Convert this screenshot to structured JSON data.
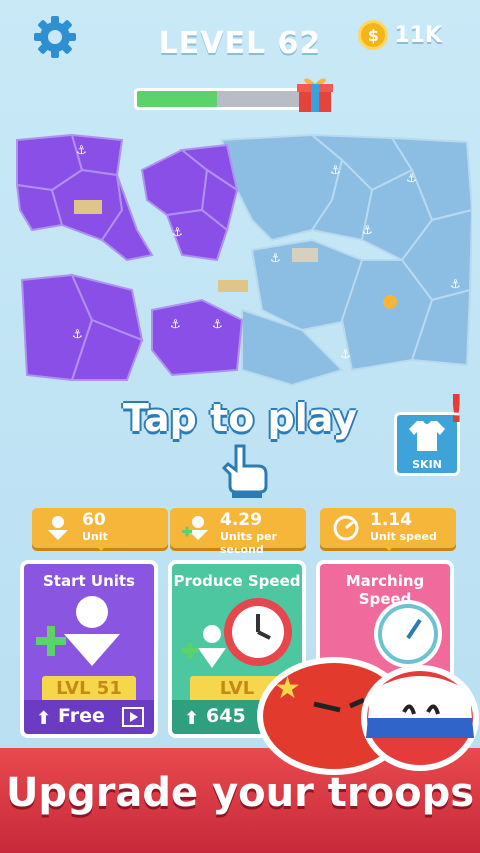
{
  "header": {
    "level": "LEVEL 62",
    "coins": "11K",
    "coin_symbol": "$",
    "progress": 0.47
  },
  "map": {
    "player_color": "#8a4fe6",
    "neutral_color": "#7fb5e0",
    "landmark_names": [
      "colosseum",
      "parthenon",
      "mosque",
      "winged-lion"
    ]
  },
  "prompt": {
    "tap_label": "Tap to play"
  },
  "skin_button": {
    "label": "SKIN",
    "alert": "!"
  },
  "upgrades": [
    {
      "stat_value": "60",
      "stat_unit": "Unit",
      "title": "Start Units",
      "level": "LVL 51",
      "cost": "Free",
      "color": "#8a55e0"
    },
    {
      "stat_value": "4.29",
      "stat_unit": "Units per second",
      "title": "Produce Speed",
      "level": "LVL",
      "cost": "645",
      "color": "#4cc7a0"
    },
    {
      "stat_value": "1.14",
      "stat_unit": "Unit speed",
      "title": "Marching Speed",
      "level": "",
      "cost": "",
      "color": "#f06a9c"
    }
  ],
  "banner": {
    "text": "Upgrade your troops"
  }
}
